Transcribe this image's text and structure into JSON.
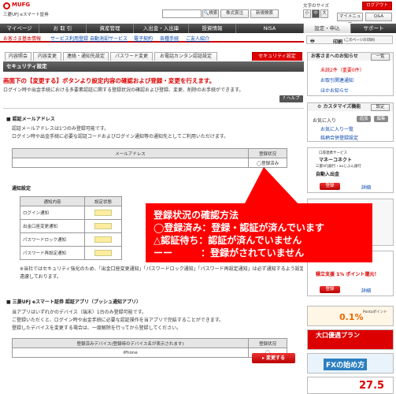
{
  "header": {
    "brand_line1": "MUFG",
    "brand_line2": "三菱UFJ eスマート証券",
    "search_button": "検索",
    "stock_price_button": "株式賞注",
    "new_window_button": "新規検索",
    "font_size_label": "文字のサイズ",
    "font_small": "小",
    "font_medium": "中",
    "font_large": "大",
    "logout_button": "ログアウト",
    "my_menu_label": "マイメニュー",
    "help_label": "Q&A"
  },
  "nav": {
    "items": [
      "マイページ",
      "お 取 引",
      "資産管理",
      "入出金・入出庫",
      "投資情報",
      "NISA",
      "設定・申込",
      "サポート"
    ]
  },
  "subnav": {
    "items": [
      "お客さま基本情報",
      "サービス利用登録",
      "自動消却サービス",
      "電子契約",
      "各種手続",
      "ご友人紹介"
    ],
    "print_label": "印刷",
    "print_note": "(このページの印刷)"
  },
  "tabs": [
    "内容照会",
    "内容変更",
    "連絡・通知先設定",
    "パスワード変更",
    "お電話カンタン認証設定",
    "セキュリティ設定"
  ],
  "section": {
    "header": "セキュリティ設定",
    "instruction_title": "画面下の【変更する】ボタンより設定内容の確認および登録・変更を行えます。",
    "instruction_sub": "ログイン時や出金手続における多要素認証に関する登録状況の確認および登録、変更、削除のお手続ができます。",
    "help_button": "ヘルプ"
  },
  "auth_email": {
    "title": "認証メールアドレス",
    "desc1": "認証メールアドレスは1つのみ登録可能です。",
    "desc2": "ログイン時や出金手続に必要な認証コードおよびログイン通知等の通知先としてご利用いただけます。",
    "col_address": "メールアドレス",
    "col_status": "登録状況",
    "rows": [
      {
        "address": "",
        "status": "◯登録済み"
      }
    ]
  },
  "notice_settings": {
    "title": "通知設定",
    "col_content": "通知内容",
    "col_status": "設定状態",
    "rows": [
      "ログイン通知",
      "出金口座変更通知",
      "パスワードロック通知",
      "パスワード再設定通知"
    ],
    "footnote1": "※当社ではセキュリティ強化のため、「出金口座変更通知」「パスワードロック通知」「パスワード再設定通知」は必ず通知するよう設定させていただいており",
    "footnote2": "遠慮しております。"
  },
  "auth_app": {
    "title": "三菱UFJ eスマート証券 認証アプリ（プッシュ通知アプリ）",
    "desc1": "当アプリはいずれかのデバイス（端末）1台のみ登録可能です。",
    "desc2": "ご登録いただくと、ログイン時や出金手続に必要な認証操作を当アプリで完結することができます。",
    "desc3": "登録したデバイスを変更する場合は、一度解除を行ってから登録してください。",
    "col_device": "登録済みデバイス(登録時のデバイス名が表示されます)",
    "col_status": "登録状況",
    "rows": [
      {
        "device": "iPhone",
        "status": "◯"
      }
    ]
  },
  "change_button": "変更する",
  "sidebar": {
    "notice_title": "お客さまへのお知らせ",
    "notice_button": "一覧",
    "notice_items": [
      "未読2件（重要0件）",
      "お取引関連通知",
      "ほかお知らせ"
    ],
    "customize_title": "カスタマイズ機能",
    "customize_button": "設定",
    "favorites_label": "お気に入り",
    "favorites_btn1": "追加",
    "favorites_btn2": "編集",
    "favorites_items": [
      "お気に入り一覧",
      "銘柄合併登録設定"
    ],
    "money_title": "口座連携サービス",
    "money_sub": "マネーコネクト",
    "bank_label": "三菱UFJ銀行・auじぶん銀行",
    "auto_deposit": "自動入出金",
    "register_btn": "登録",
    "detail_link": "詳細",
    "promo_rate": "積立支援 1% ポイント還元！",
    "promo_register": "登録",
    "promo_detail": "詳細",
    "ponta_text": "0.1%",
    "ponta_label": "Pontaポイント",
    "big_campaign": "大口優遇プラン",
    "fx_text": "FXの始め方",
    "bottom_promo": "27.5"
  },
  "callout": {
    "line1": "登録状況の確認方法",
    "line2": "◯登録済み：登録・認証が済んでいます",
    "line3": "△認証待ち：認証が済んでいません",
    "line4": "ーー　　　：登録がされていません",
    "color": "#ff0000"
  },
  "colors": {
    "brand_red": "#dd0000",
    "nav_dark": "#3a3a3a",
    "link_blue": "#0645ad"
  }
}
